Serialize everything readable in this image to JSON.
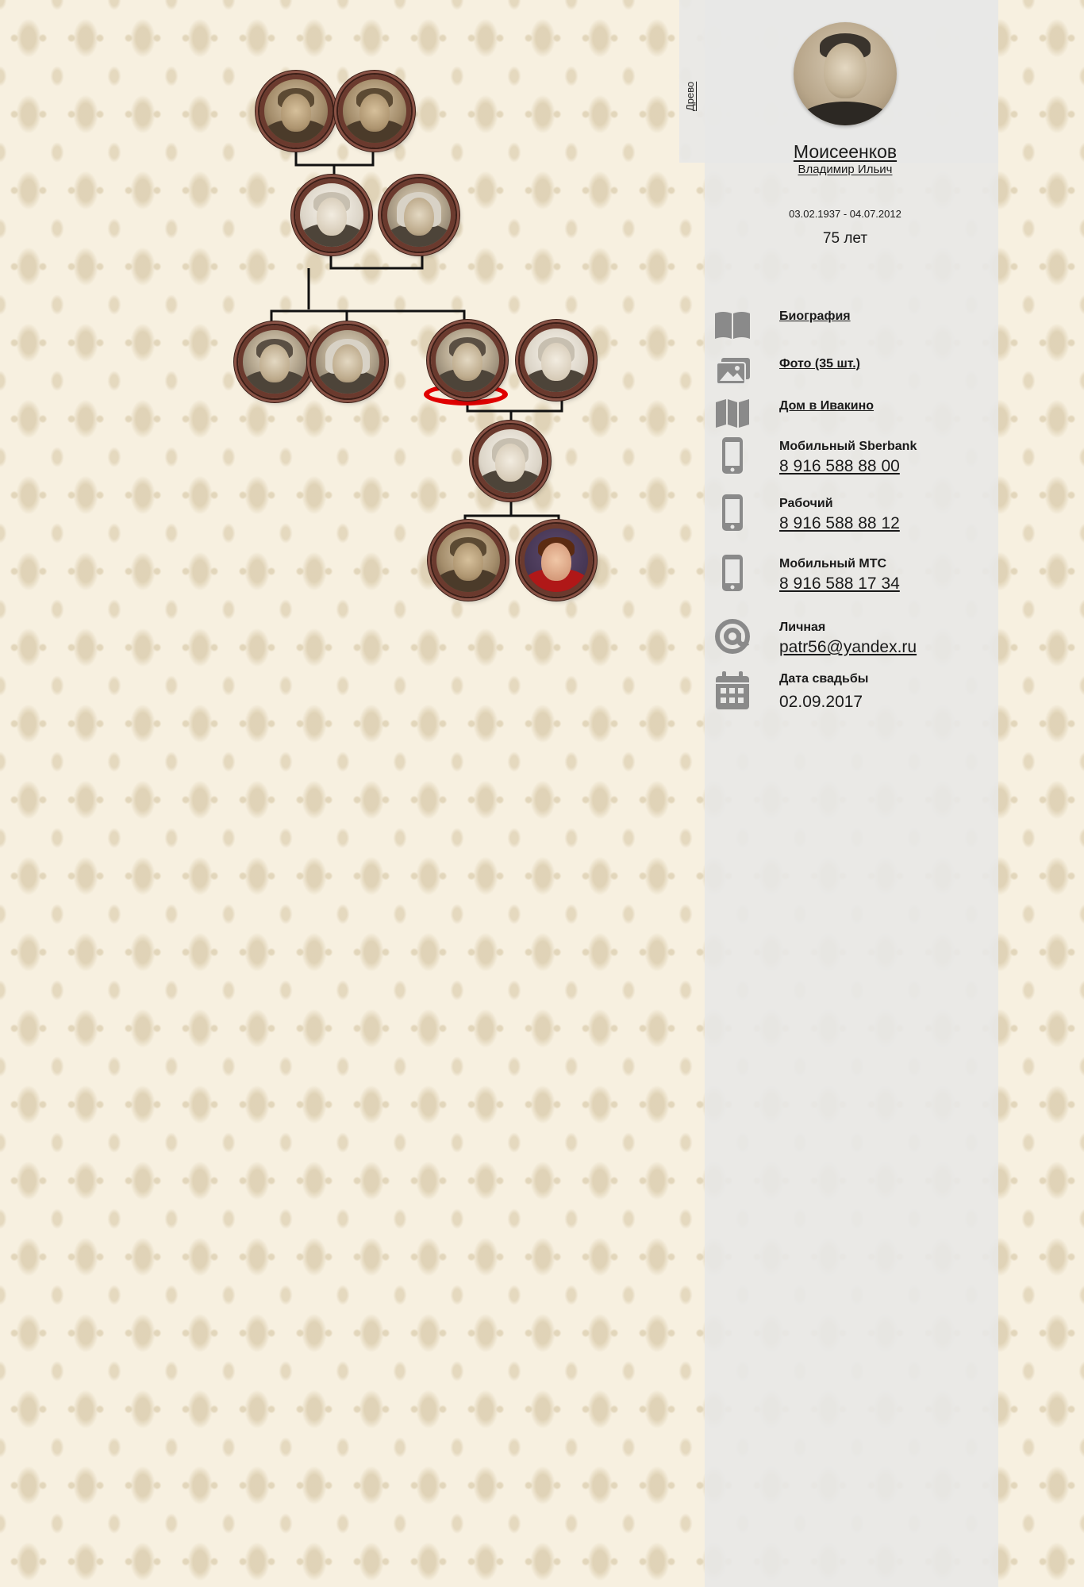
{
  "sidebar": {
    "tab_label": "Древо",
    "profile": {
      "last_name": "Моисеенков",
      "first_middle_name": "Владимир Ильич",
      "dates": "03.02.1937 - 04.07.2012",
      "age": "75 лет"
    },
    "links": {
      "biography": "Биография",
      "photos": "Фото (35 шт.)",
      "house": "Дом в Ивакино"
    },
    "contacts": [
      {
        "label": "Мобильный Sberbank",
        "value": "8 916 588 88 00",
        "icon": "mobile-phone-icon"
      },
      {
        "label": "Рабочий",
        "value": "8 916 588 88 12",
        "icon": "mobile-phone-icon"
      },
      {
        "label": "Мобильный МТС",
        "value": "8 916 588 17 34",
        "icon": "mobile-phone-icon"
      },
      {
        "label": "Личная",
        "value": "patr56@yandex.ru",
        "icon": "at-sign-icon"
      }
    ],
    "wedding": {
      "label": "Дата свадьбы",
      "value": "02.09.2017",
      "icon": "calendar-icon"
    }
  },
  "colors": {
    "selected_marker": "#e00000",
    "frame": "#6b3a2e",
    "icon": "#8a8a8a",
    "connector": "#111111"
  }
}
